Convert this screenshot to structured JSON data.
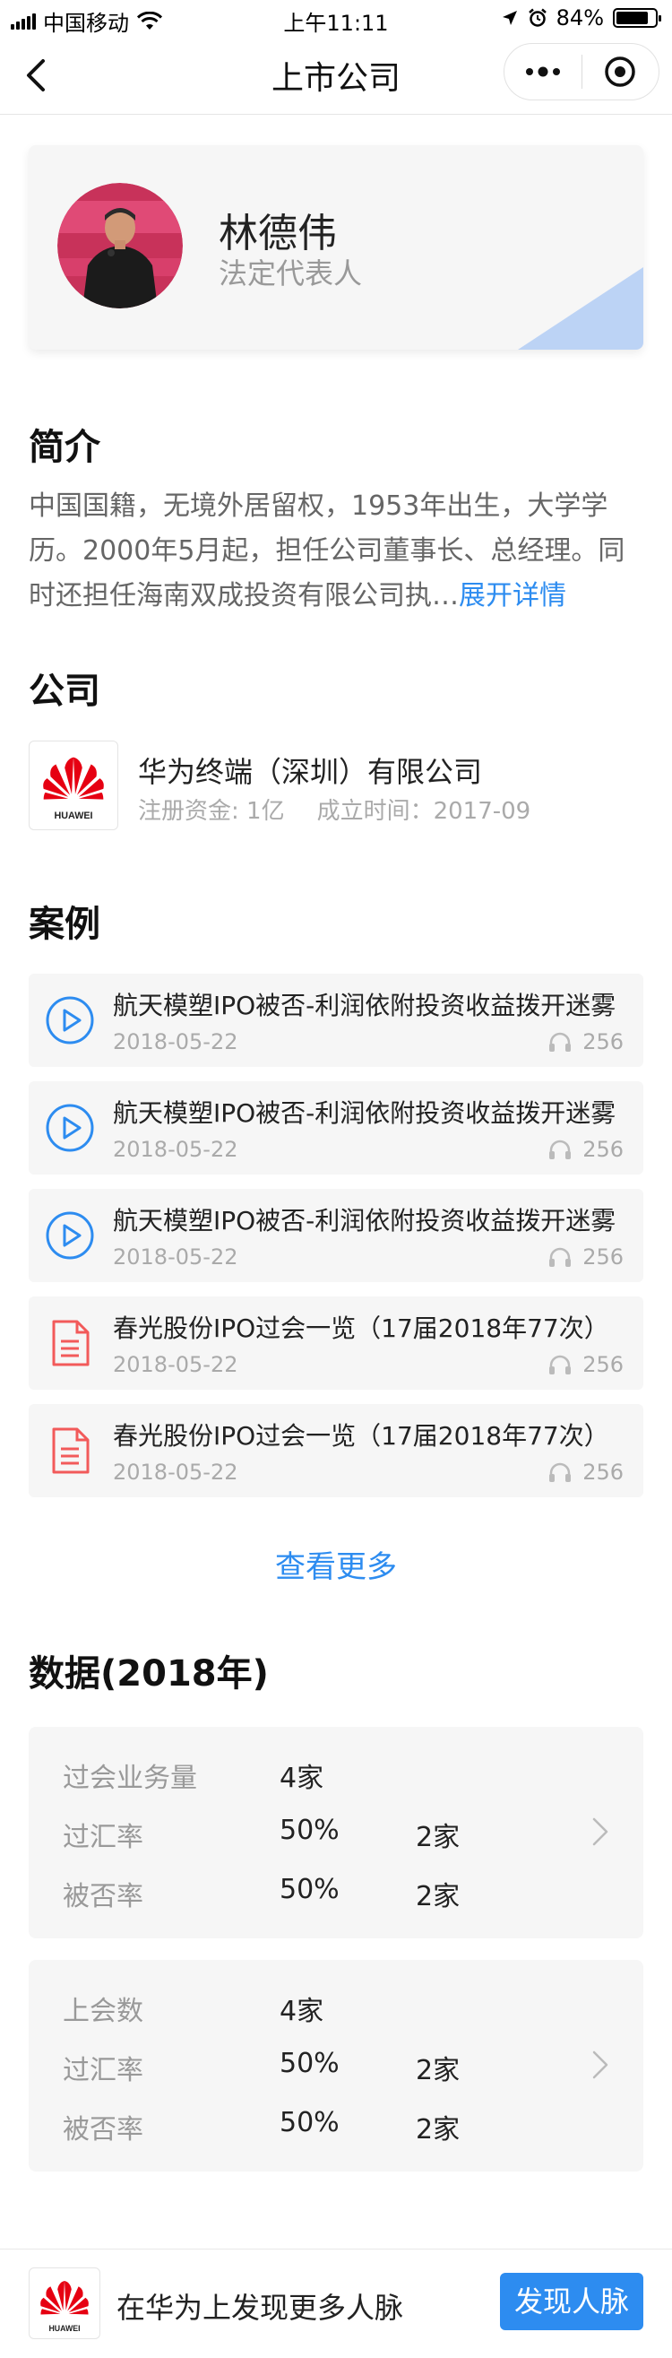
{
  "status_bar": {
    "carrier": "中国移动",
    "time": "上午11:11",
    "battery_text": "84%",
    "battery_level": 0.84
  },
  "nav": {
    "title": "上市公司"
  },
  "profile": {
    "name": "林德伟",
    "role": "法定代表人"
  },
  "intro": {
    "title": "简介",
    "text": "中国国籍，无境外居留权，1953年出生，大学学历。2000年5月起，担任公司董事长、总经理。同时还担任海南双成投资有限公司执…",
    "expand_label": "展开详情"
  },
  "company": {
    "title": "公司",
    "logo_text": "HUAWEI",
    "name": "华为终端（深圳）有限公司",
    "capital": "注册资金: 1亿",
    "founded": "成立时间：2017-09"
  },
  "cases": {
    "title": "案例",
    "items": [
      {
        "type": "video",
        "title": "航天模塑IPO被否-利润依附投资收益拨开迷雾",
        "date": "2018-05-22",
        "count": "256"
      },
      {
        "type": "video",
        "title": "航天模塑IPO被否-利润依附投资收益拨开迷雾",
        "date": "2018-05-22",
        "count": "256"
      },
      {
        "type": "video",
        "title": "航天模塑IPO被否-利润依附投资收益拨开迷雾",
        "date": "2018-05-22",
        "count": "256"
      },
      {
        "type": "document",
        "title": "春光股份IPO过会一览（17届2018年77次）",
        "date": "2018-05-22",
        "count": "256"
      },
      {
        "type": "document",
        "title": "春光股份IPO过会一览（17届2018年77次）",
        "date": "2018-05-22",
        "count": "256"
      }
    ],
    "more_label": "查看更多"
  },
  "data": {
    "title": "数据(2018年)",
    "cards": [
      {
        "rows": [
          {
            "label": "过会业务量",
            "v1": "4家",
            "v2": ""
          },
          {
            "label": "过汇率",
            "v1": "50%",
            "v2": "2家"
          },
          {
            "label": "被否率",
            "v1": "50%",
            "v2": "2家"
          }
        ]
      },
      {
        "rows": [
          {
            "label": "上会数",
            "v1": "4家",
            "v2": ""
          },
          {
            "label": "过汇率",
            "v1": "50%",
            "v2": "2家"
          },
          {
            "label": "被否率",
            "v1": "50%",
            "v2": "2家"
          }
        ]
      }
    ]
  },
  "bottom_bar": {
    "logo_text": "HUAWEI",
    "text": "在华为上发现更多人脉",
    "button_label": "发现人脉"
  },
  "colors": {
    "accent": "#2d8cf0",
    "huawei_red": "#e60012",
    "doc_red": "#f25a5a"
  }
}
